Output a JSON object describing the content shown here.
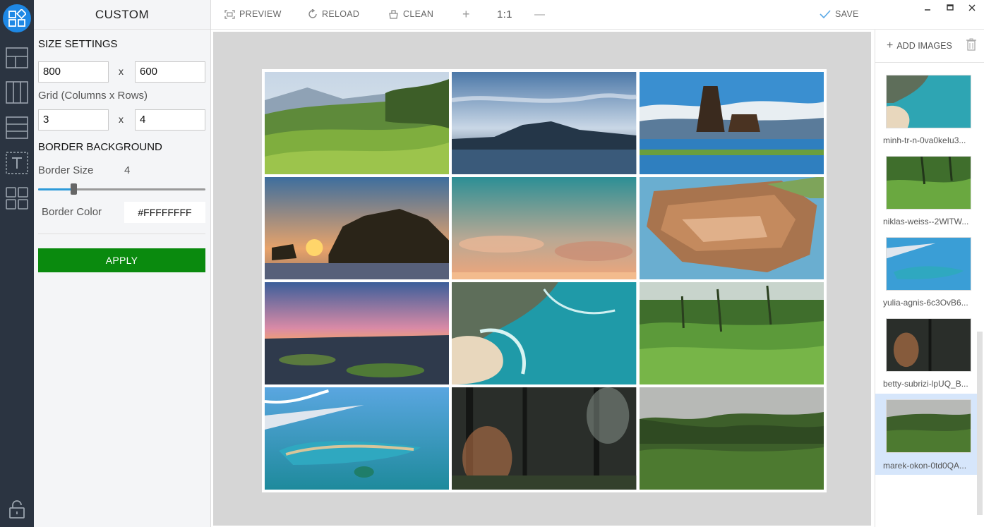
{
  "settings": {
    "title": "CUSTOM",
    "size_heading": "SIZE SETTINGS",
    "width": "800",
    "height": "600",
    "times": "x",
    "grid_label": "Grid (Columns x Rows)",
    "columns": "3",
    "rows": "4",
    "border_heading": "BORDER BACKGROUND",
    "border_size_label": "Border Size",
    "border_size_value": "4",
    "border_size_fraction": 0.21,
    "border_color_label": "Border Color",
    "border_color_value": "#FFFFFFFF",
    "apply_label": "APPLY"
  },
  "toolbar": {
    "preview": "PREVIEW",
    "reload": "RELOAD",
    "clean": "CLEAN",
    "zoom_in": "+",
    "zoom_reset": "1:1",
    "zoom_out": "—",
    "save": "SAVE"
  },
  "rail": {
    "items": [
      "custom-layout-icon",
      "two-column-layout-icon",
      "three-column-layout-icon",
      "three-row-layout-icon",
      "text-icon",
      "grid-layout-icon"
    ],
    "bottom": "lock-icon"
  },
  "images_panel": {
    "add_label": "ADD IMAGES",
    "items": [
      {
        "name": "minh-tr-n-0va0keIu3..."
      },
      {
        "name": "niklas-weiss--2WlTW..."
      },
      {
        "name": "yulia-agnis-6c3OvB6..."
      },
      {
        "name": "betty-subrizi-lpUQ_B..."
      },
      {
        "name": "marek-okon-0td0QA..."
      }
    ],
    "selected_index": 4
  },
  "colors": {
    "accent": "#1e88e5",
    "apply": "#0a8a0e",
    "rail_bg": "#2b3441",
    "selected_bg": "#d6e6fb"
  }
}
